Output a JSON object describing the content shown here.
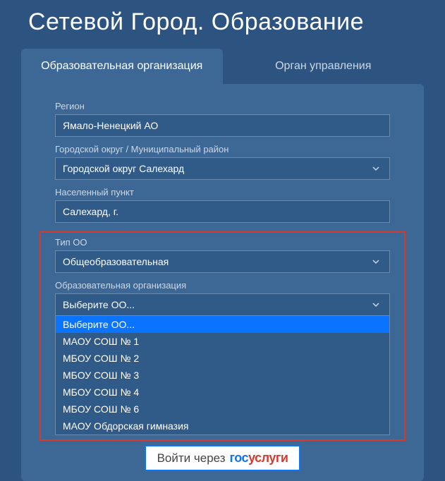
{
  "title": "Сетевой Город. Образование",
  "tabs": {
    "org": "Образовательная организация",
    "gov": "Орган управления"
  },
  "fields": {
    "region": {
      "label": "Регион",
      "value": "Ямало-Ненецкий АО"
    },
    "district": {
      "label": "Городской округ / Муниципальный район",
      "value": "Городской округ Салехард"
    },
    "locality": {
      "label": "Населенный пункт",
      "value": "Салехард, г."
    },
    "ootype": {
      "label": "Тип ОО",
      "value": "Общеобразовательная"
    },
    "org": {
      "label": "Образовательная организация",
      "value": "Выберите ОО...",
      "options": [
        "Выберите ОО...",
        "МАОУ СОШ № 1",
        "МБОУ СОШ № 2",
        "МБОУ СОШ № 3",
        "МБОУ СОШ № 4",
        "МБОУ СОШ № 6",
        "МАОУ Обдорская гимназия"
      ]
    }
  },
  "login": {
    "prefix": "Войти через",
    "brand_gos": "гос",
    "brand_uslugi": "услуги"
  }
}
